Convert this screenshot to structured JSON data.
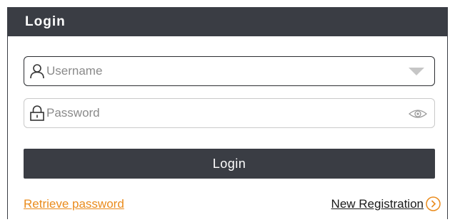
{
  "header": {
    "title": "Login"
  },
  "username": {
    "placeholder": "Username",
    "value": "",
    "icon": "user-icon"
  },
  "password": {
    "placeholder": "Password",
    "value": "",
    "icon": "lock-icon",
    "toggle_icon": "eye-icon"
  },
  "login_button": {
    "label": "Login"
  },
  "links": {
    "retrieve_password": "Retrieve password",
    "new_registration": "New Registration",
    "new_registration_icon": "chevron-right-circle-icon"
  },
  "colors": {
    "header_bg": "#3a3d44",
    "button_bg": "#3a3d44",
    "link_accent": "#ea8b1c"
  }
}
